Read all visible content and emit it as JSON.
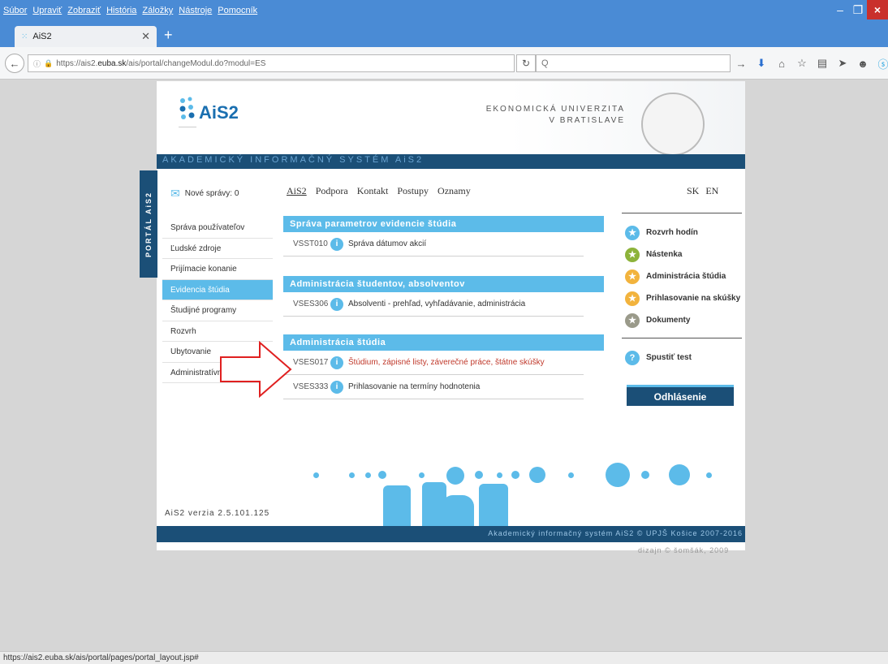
{
  "browser": {
    "menu": [
      "Súbor",
      "Upraviť",
      "Zobraziť",
      "História",
      "Záložky",
      "Nástroje",
      "Pomocník"
    ],
    "tab_title": "AiS2",
    "url_prefix": "https://ais2.",
    "url_host": "euba.sk",
    "url_path": "/ais/portal/changeModul.do?modul=ES",
    "search_placeholder": "Q",
    "status_url": "https://ais2.euba.sk/ais/portal/pages/portal_layout.jsp#"
  },
  "header": {
    "logo": "AiS2",
    "university_line1": "EKONOMICKÁ UNIVERZITA",
    "university_line2": "V BRATISLAVE",
    "band": "AKADEMICKÝ INFORMAČNÝ SYSTÉM AiS2",
    "portal_tab": "PORTÁL AiS2"
  },
  "messages": "Nové správy: 0",
  "topnav": [
    "AiS2",
    "Podpora",
    "Kontakt",
    "Postupy",
    "Oznamy"
  ],
  "lang": [
    "SK",
    "EN"
  ],
  "sidebar": [
    {
      "label": "Správa používateľov",
      "active": false
    },
    {
      "label": "Ľudské zdroje",
      "active": false
    },
    {
      "label": "Prijímacie konanie",
      "active": false
    },
    {
      "label": "Evidencia štúdia",
      "active": true
    },
    {
      "label": "Študijné programy",
      "active": false
    },
    {
      "label": "Rozvrh",
      "active": false
    },
    {
      "label": "Ubytovanie",
      "active": false
    },
    {
      "label": "Administratívny systém",
      "active": false
    }
  ],
  "sections": [
    {
      "title": "Správa parametrov evidencie štúdia",
      "rows": [
        {
          "code": "VSST010",
          "label": "Správa dátumov akcií"
        }
      ]
    },
    {
      "title": "Administrácia študentov, absolventov",
      "rows": [
        {
          "code": "VSES306",
          "label": "Absolventi - prehľad, vyhľadávanie, administrácia"
        }
      ]
    },
    {
      "title": "Administrácia štúdia",
      "rows": [
        {
          "code": "VSES017",
          "label": "Štúdium, zápisné listy, záverečné práce, štátne skúšky"
        },
        {
          "code": "VSES333",
          "label": "Prihlasovanie na termíny hodnotenia"
        }
      ]
    }
  ],
  "rightbar": {
    "items": [
      {
        "label": "Rozvrh hodín",
        "color": "#5cbbe9"
      },
      {
        "label": "Nástenka",
        "color": "#8db33a"
      },
      {
        "label": "Administrácia štúdia",
        "color": "#f2b33d"
      },
      {
        "label": "Prihlasovanie na skúšky",
        "color": "#f2b33d"
      },
      {
        "label": "Dokumenty",
        "color": "#9a9a8a"
      }
    ],
    "test": "Spustiť test",
    "logout": "Odhlásenie"
  },
  "footer": {
    "version": "AiS2 verzia 2.5.101.125",
    "copyright": "Akademický informačný systém AiS2 © UPJŠ Košice 2007-2016",
    "design": "dizajn © šomšák, 2009"
  }
}
